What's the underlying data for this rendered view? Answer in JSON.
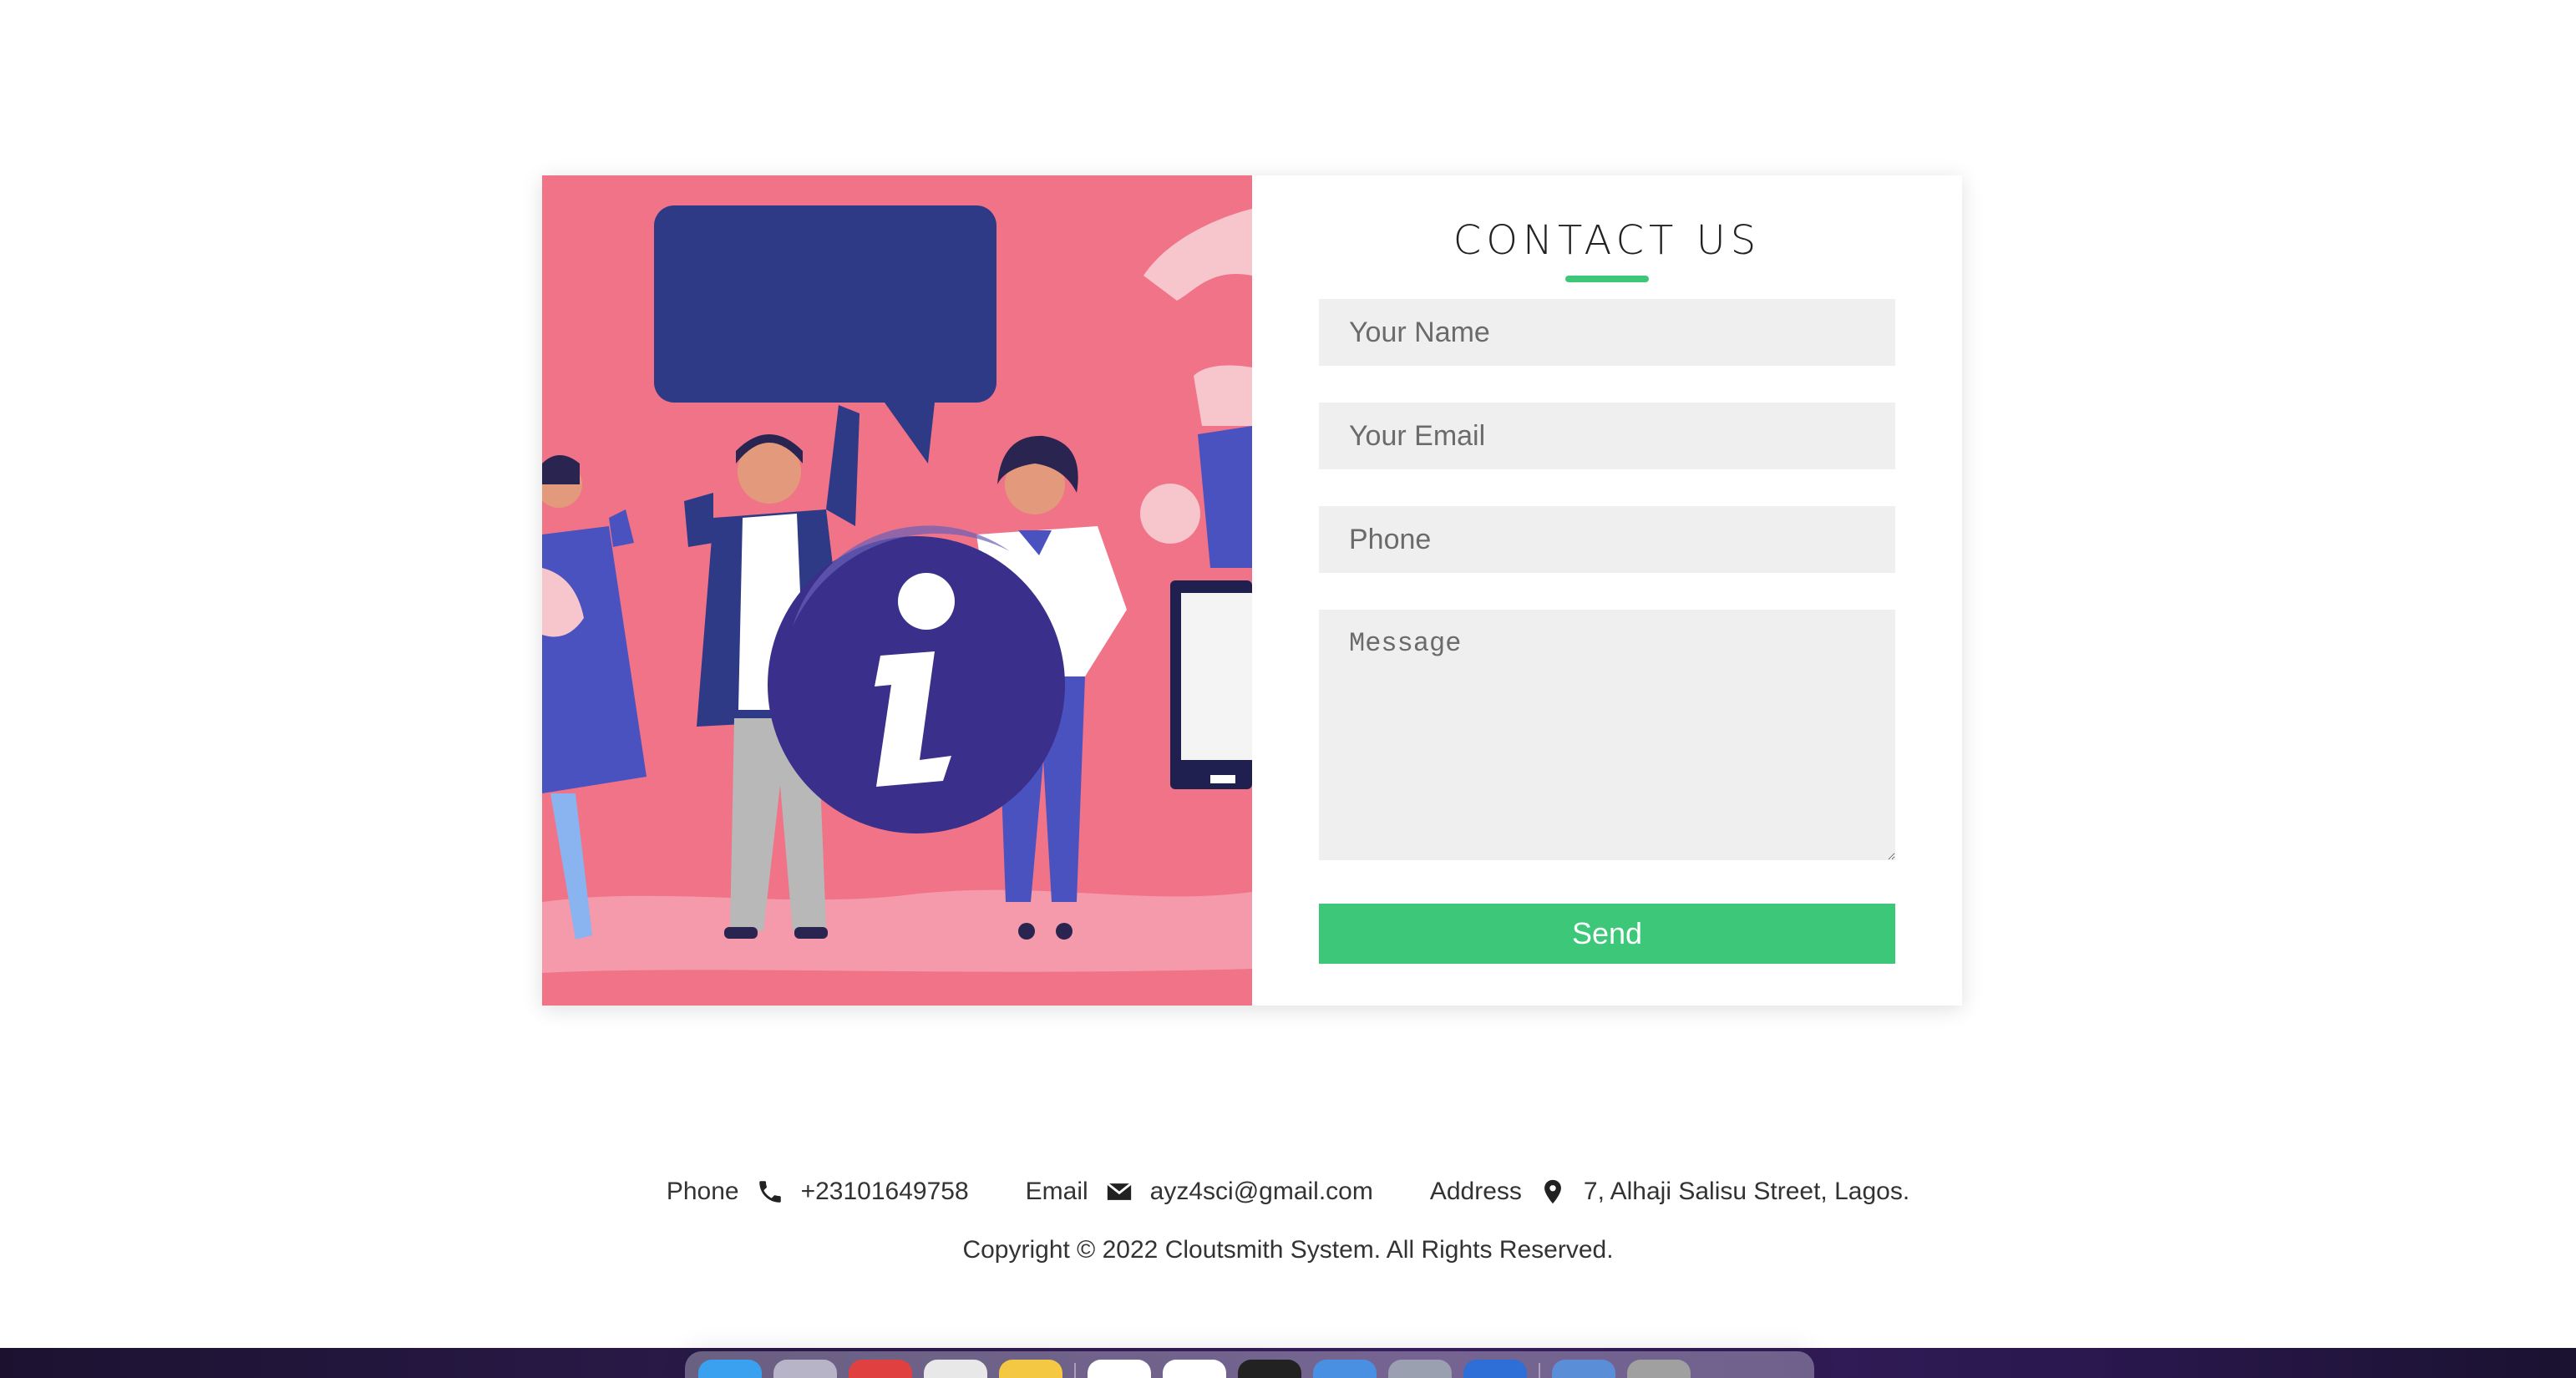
{
  "contact": {
    "title": "CONTACT US",
    "name_placeholder": "Your Name",
    "email_placeholder": "Your Email",
    "phone_placeholder": "Phone",
    "message_placeholder": "Message",
    "send_label": "Send"
  },
  "footer": {
    "phone_label": "Phone",
    "phone_value": "+23101649758",
    "email_label": "Email",
    "email_value": "ayz4sci@gmail.com",
    "address_label": "Address",
    "address_value": "7, Alhaji Salisu Street, Lagos.",
    "copyright": "Copyright © 2022 Cloutsmith System. All Rights Reserved."
  },
  "colors": {
    "accent": "#3cc878",
    "illustration_bg": "#f07387",
    "field_bg": "#efefef"
  },
  "icons": {
    "phone": "phone-icon",
    "email": "envelope-icon",
    "address": "map-pin-icon",
    "info": "info-icon"
  },
  "dock": {
    "icon_colors": [
      "#3aa0f0",
      "#b8b4c8",
      "#e04040",
      "#e8e8e8",
      "#f4c842",
      "#ffffff",
      "#ffffff",
      "#222222",
      "#4a90e2",
      "#9aa0b0",
      "#2d6fd6",
      "#5a8fd8",
      "#a0a0a0"
    ]
  }
}
